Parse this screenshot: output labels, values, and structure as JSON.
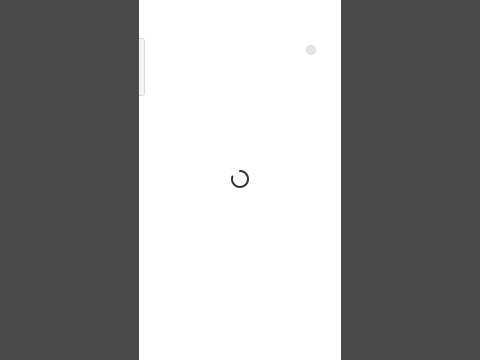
{
  "viewport": {
    "background_color": "#4a4a4a",
    "page_background_color": "#ffffff"
  },
  "page": {
    "side_tab": {
      "label": ""
    },
    "status_dot": {
      "color": "#e6e6e6"
    },
    "loading": {
      "icon": "loading-spinner-icon",
      "color": "#333333"
    }
  }
}
